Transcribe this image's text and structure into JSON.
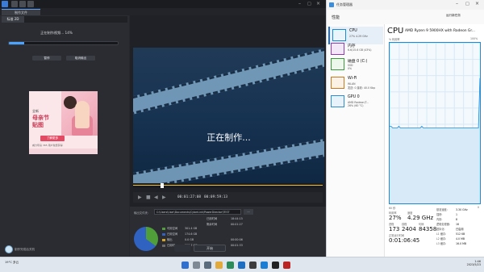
{
  "powerdirector": {
    "tabs": [
      "制作文件",
      "",
      "",
      "",
      ""
    ],
    "left_tabs": [
      "标准 2D",
      "",
      "",
      "",
      ""
    ],
    "progress_text": "正在制作视频... 14%",
    "progress": 0.14,
    "buttons": {
      "pause": "暂停",
      "cancel": "取消输出"
    },
    "ad": {
      "line1": "全新",
      "line2": "母亲节",
      "line3": "贴图",
      "button": "了解更多",
      "footer": "威力导演 365 用户免费获得"
    },
    "left_bottom_text": "制作完成后关机",
    "preview_caption": "正在制作...",
    "timecode_current": "00:01:27:08",
    "timecode_total": "00:09:59:13",
    "output": {
      "path_label": "输出文件夹:",
      "path": "C:\\Users\\User\\Documents\\CyberLink\\PowerDirector\\TEST",
      "browse": "...",
      "legend": [
        {
          "label": "可用空间",
          "value": "301.4 GB",
          "color": "#4f9e3a"
        },
        {
          "label": "已用空间",
          "value": "174.6 GB",
          "color": "#2f62c1"
        },
        {
          "label": "输出",
          "value": "0.0 GB",
          "color": "#d7a324"
        },
        {
          "label": "已用时",
          "value": "557.7 MB",
          "color": "#6a6a6a"
        }
      ],
      "stats": [
        {
          "label": "已用时间",
          "value": "18:44:15"
        },
        {
          "label": "剩余时间",
          "value": "00:01:27"
        },
        {
          "label": "",
          "value": "00:00:06"
        },
        {
          "label": "",
          "value": "00:01:33"
        }
      ]
    },
    "produce_button": "开始"
  },
  "task_manager": {
    "title": "任务管理器",
    "heading": "性能",
    "run_task": "运行新任务",
    "resources": [
      {
        "name": "CPU",
        "sub": "27% 4.29 GHz"
      },
      {
        "name": "内存",
        "sub": "6.6/15.6 GB (43%)"
      },
      {
        "name": "磁盘 0 (C:)",
        "sub": "SSD\n0%"
      },
      {
        "name": "Wi-Fi",
        "sub": "WLAN\n发送: 0 接收: 40.0 Kbp"
      },
      {
        "name": "GPU 0",
        "sub": "AMD Radeon(T...\n26% (60 °C)"
      }
    ],
    "cpu_title": "CPU",
    "cpu_model": "AMD Ryzen 9 5900HX with Radeon Gr...",
    "graph_label": "% 利用率",
    "graph_max": "100%",
    "graph_time": "60 秒",
    "graph_zero": "0",
    "utilization": [
      48,
      48,
      47,
      47,
      47,
      47,
      48,
      47,
      47,
      47,
      47,
      47,
      47,
      47,
      47,
      47,
      47,
      47,
      47,
      47,
      47,
      48,
      47,
      47,
      47,
      47,
      47,
      47,
      47,
      47,
      47,
      47,
      47,
      47,
      47,
      47,
      47,
      47,
      47,
      47,
      47,
      47,
      47,
      47,
      47,
      47,
      47,
      47,
      47,
      47,
      47,
      47,
      47,
      47,
      47,
      47,
      47,
      47,
      47,
      78
    ],
    "stats": {
      "util_label": "利用率",
      "util_value": "27%",
      "speed_label": "速度",
      "speed_value": "4.29 GHz",
      "proc_label": "进程",
      "proc_value": "173",
      "threads_label": "线程",
      "threads_value": "2404",
      "handles_label": "句柄",
      "handles_value": "84358",
      "uptime_label": "正常运行时间",
      "uptime_value": "0:01:06:45"
    },
    "right_stats": [
      {
        "label": "基准速度:",
        "value": "3.30 GHz"
      },
      {
        "label": "插槽:",
        "value": "1"
      },
      {
        "label": "内核:",
        "value": "8"
      },
      {
        "label": "逻辑处理器:",
        "value": "16"
      },
      {
        "label": "虚拟化:",
        "value": "已启用"
      },
      {
        "label": "L1 缓存:",
        "value": "512 KB"
      },
      {
        "label": "L2 缓存:",
        "value": "4.0 MB"
      },
      {
        "label": "L3 缓存:",
        "value": "16.0 MB"
      }
    ]
  },
  "taskbar": {
    "weather": "19°C 多云",
    "time": "1:46",
    "date": "2023/5/23"
  },
  "watermark": "值 什么值得买"
}
